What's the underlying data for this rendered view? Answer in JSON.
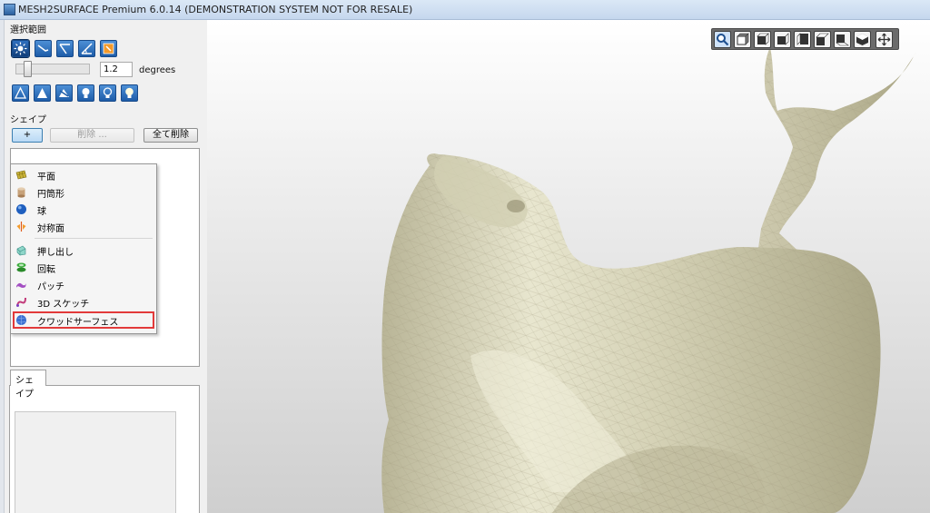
{
  "window": {
    "title": "MESH2SURFACE Premium 6.0.14 (DEMONSTRATION SYSTEM NOT FOR RESALE)"
  },
  "selection": {
    "heading": "選択範囲",
    "tools_row1": [
      "select-brush-icon",
      "select-lasso-icon",
      "select-line-icon",
      "select-angle-icon",
      "select-paint-icon"
    ],
    "angle_value": "1.2",
    "angle_unit": "degrees",
    "tools_row2": [
      "triangle-outline-icon",
      "triangle-filled-icon",
      "shape-cut-icon",
      "bulb-icon",
      "bulb-outline-icon",
      "bulb-light-icon"
    ]
  },
  "shapes": {
    "heading": "シェイプ",
    "add_label": "+",
    "delete_label": "削除 ...",
    "delete_all_label": "全て削除"
  },
  "menu": {
    "items": [
      {
        "label": "平面",
        "icon": "plane-icon"
      },
      {
        "label": "円筒形",
        "icon": "cylinder-icon"
      },
      {
        "label": "球",
        "icon": "sphere-icon"
      },
      {
        "label": "対称面",
        "icon": "symmetry-plane-icon"
      },
      {
        "label": "押し出し",
        "icon": "extrude-icon"
      },
      {
        "label": "回転",
        "icon": "revolve-icon"
      },
      {
        "label": "パッチ",
        "icon": "patch-icon"
      },
      {
        "label": "3D スケッチ",
        "icon": "sketch-3d-icon"
      },
      {
        "label": "クワッドサーフェス",
        "icon": "quad-surface-icon",
        "highlighted": true
      }
    ]
  },
  "bottom_tab": {
    "label": "シェイプ"
  },
  "viewport": {
    "toolbar": [
      "zoom-fit-icon",
      "view-front-icon",
      "view-back-icon",
      "view-left-icon",
      "view-right-icon",
      "view-top-icon",
      "view-bottom-icon",
      "view-iso-icon",
      "view-rotate-icon"
    ],
    "model_color": "#c9c6a8"
  }
}
